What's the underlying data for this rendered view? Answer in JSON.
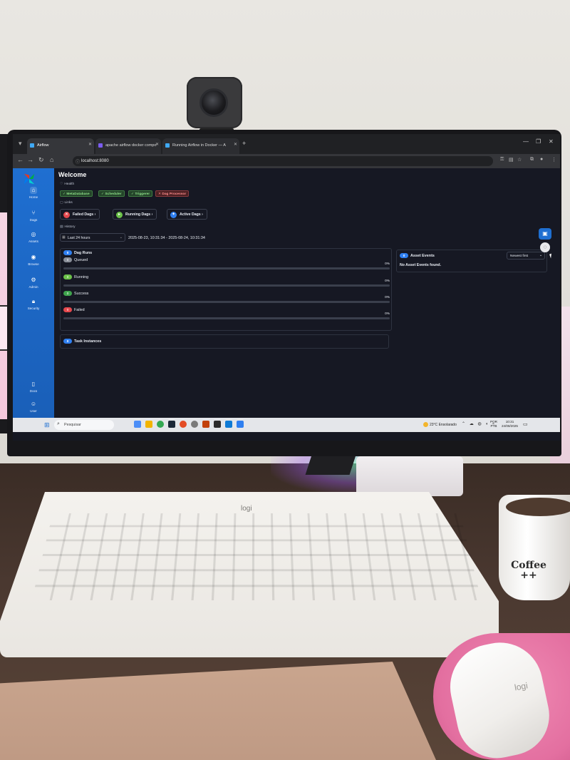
{
  "browser": {
    "tabs": [
      {
        "label": "Airflow",
        "active": true
      },
      {
        "label": "apache airflow docker compo",
        "active": false
      },
      {
        "label": "Running Airflow in Docker — A",
        "active": false
      }
    ],
    "url": "localhost:8080"
  },
  "sidebar": {
    "items": [
      {
        "label": "Home",
        "icon": "home-icon"
      },
      {
        "label": "Dags",
        "icon": "dags-icon"
      },
      {
        "label": "Assets",
        "icon": "assets-icon"
      },
      {
        "label": "Browse",
        "icon": "browse-icon"
      },
      {
        "label": "Admin",
        "icon": "admin-gear-icon"
      },
      {
        "label": "Security",
        "icon": "lock-icon"
      },
      {
        "label": "Docs",
        "icon": "book-icon"
      },
      {
        "label": "User",
        "icon": "user-icon"
      }
    ]
  },
  "page": {
    "title": "Welcome",
    "health_label": "Health",
    "health": [
      {
        "label": "MetaDatabase",
        "status": "ok"
      },
      {
        "label": "Scheduler",
        "status": "ok"
      },
      {
        "label": "Triggerer",
        "status": "ok"
      },
      {
        "label": "Dag Processor",
        "status": "bad"
      }
    ],
    "links_label": "Links",
    "links": [
      {
        "label": "Failed Dags",
        "color": "#e5484d"
      },
      {
        "label": "Running Dags",
        "color": "#6cc24a"
      },
      {
        "label": "Active Dags",
        "color": "#2f7ff0"
      }
    ],
    "history_label": "History",
    "range_select": "Last 24 hours",
    "range_text": "2025-08-23, 10:31:34 - 2025-08-24, 10:31:34",
    "dag_runs": {
      "count": "0",
      "label": "Dag Runs",
      "states": [
        {
          "name": "Queued",
          "count": "0",
          "percent": "0%",
          "fill": 0,
          "color": "#8a8f99"
        },
        {
          "name": "Running",
          "count": "0",
          "percent": "0%",
          "fill": 0,
          "color": "#6cc24a"
        },
        {
          "name": "Success",
          "count": "0",
          "percent": "0%",
          "fill": 0,
          "color": "#3fa34d"
        },
        {
          "name": "Failed",
          "count": "0",
          "percent": "0%",
          "fill": 0,
          "color": "#e5484d"
        }
      ]
    },
    "task_instances": {
      "count": "0",
      "label": "Task Instances"
    },
    "asset_events": {
      "count": "0",
      "label": "Asset Events",
      "sort": "Newest first",
      "empty": "No Asset Events found."
    }
  },
  "taskbar": {
    "search_placeholder": "Pesquisar",
    "weather_temp": "23°C",
    "weather_text": "Ensolarado",
    "lang_top": "POR",
    "lang_bottom": "PTB",
    "time": "10:31",
    "date": "24/08/2025"
  },
  "scene": {
    "keyboard_brand": "logi",
    "mouse_brand": "logi",
    "mug_text_1": "Coffee",
    "mug_text_2": "++"
  }
}
